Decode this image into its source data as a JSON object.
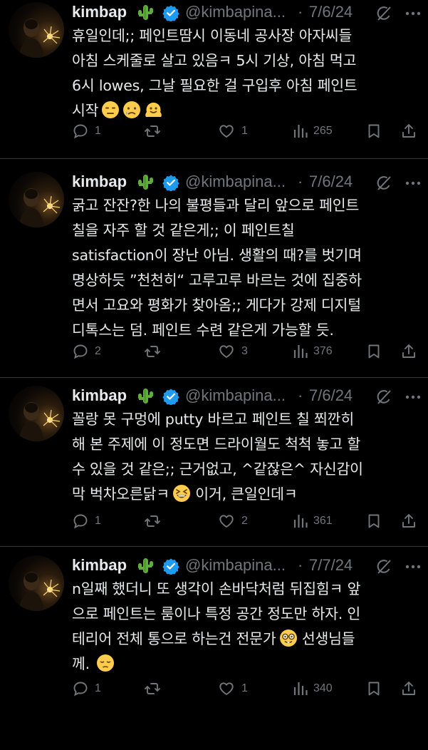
{
  "theme": {
    "background": "#000000",
    "text": "#e7e9ea",
    "muted": "#71767b",
    "verified": "#1d9bf0",
    "separator": "#2f3336"
  },
  "tweets": [
    {
      "name": "kimbap",
      "name_emoji": "cactus",
      "handle": "@kimbapina...",
      "dot": "·",
      "date": "7/6/24",
      "lines": [
        "휴일인데;; 페인트땀시 이동네 공사장 아자씨들",
        "아침 스케줄로 살고 있음ㅋ 5시 기상, 아침 먹고",
        "6시 lowes, 그날 필요한 걸 구입후 아침 페인트",
        "시작"
      ],
      "end_emojis": [
        "expressionless-face",
        "sad-tear-face",
        "melting-face"
      ],
      "replies": "1",
      "reposts": "",
      "likes": "1",
      "views": "265"
    },
    {
      "name": "kimbap",
      "name_emoji": "cactus",
      "handle": "@kimbapina...",
      "dot": "·",
      "date": "7/6/24",
      "lines": [
        "굵고 잔잔?한 나의 불평들과 달리 앞으로 페인트",
        "칠을 자주 할 것 같은게;; 이 페인트칠",
        "satisfaction이 장난 아님. 생활의 때?를 벗기며",
        "명상하듯 ”천천히“ 고루고루 바르는 것에 집중하",
        "면서 고요와 평화가 찾아옴;; 게다가 강제 디지털",
        "디톡스는 덤. 페인트 수련 같은게 가능할 듯."
      ],
      "end_emojis": [],
      "replies": "2",
      "reposts": "",
      "likes": "3",
      "views": "376"
    },
    {
      "name": "kimbap",
      "name_emoji": "cactus",
      "handle": "@kimbapina...",
      "dot": "·",
      "date": "7/6/24",
      "lines": [
        "꼴랑 못 구멍에 putty 바르고 페인트 칠 쬐깐히",
        "해 본 주제에 이 정도면 드라이월도 척척 놓고 할",
        "수 있을 것 같은;; 근거없고, ^같잖은^ 자신감이",
        "막 벅차오른닭ㅋ",
        " 이거, 큰일인데ㅋ"
      ],
      "end_emojis": [
        "grinning-squinting-face"
      ],
      "replies": "1",
      "reposts": "",
      "likes": "2",
      "views": "361"
    },
    {
      "name": "kimbap",
      "name_emoji": "cactus",
      "handle": "@kimbapina...",
      "dot": "·",
      "date": "7/7/24",
      "lines": [
        "n일째 했더니 또 생각이 손바닥처럼 뒤집힘ㅋ 앞",
        "으로 페인트는 룸이나 특정 공간 정도만 하자. 인",
        "테리어 전체 통으로 하는건 전문가",
        " 선생님들",
        "께."
      ],
      "end_emojis": [
        "nerd-face",
        "pensive-face"
      ],
      "replies": "1",
      "reposts": "",
      "likes": "1",
      "views": "340"
    }
  ],
  "icons": {
    "reply": "reply-icon",
    "repost": "repost-icon",
    "like": "heart-icon",
    "views": "views-icon",
    "bookmark": "bookmark-icon",
    "share": "share-icon",
    "grok": "grok-icon",
    "more": "more-icon",
    "verified": "verified-badge-icon"
  }
}
